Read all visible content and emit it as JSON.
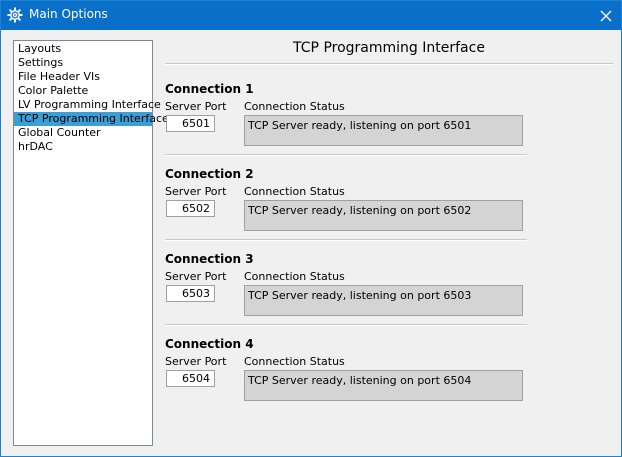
{
  "window": {
    "title": "Main Options",
    "title_icon": "gear-icon",
    "close_icon": "close-icon",
    "titlebar_color": "#0a6fc9"
  },
  "sidebar": {
    "items": [
      {
        "label": "Layouts",
        "selected": false
      },
      {
        "label": "Settings",
        "selected": false
      },
      {
        "label": "File Header VIs",
        "selected": false
      },
      {
        "label": "Color Palette",
        "selected": false
      },
      {
        "label": "LV Programming Interface",
        "selected": false
      },
      {
        "label": "TCP Programming Interface",
        "selected": true
      },
      {
        "label": "Global Counter",
        "selected": false
      },
      {
        "label": "hrDAC",
        "selected": false
      }
    ],
    "selected_color": "#3b9fd6"
  },
  "main": {
    "title": "TCP Programming Interface",
    "connections": [
      {
        "heading": "Connection 1",
        "port_label": "Server Port",
        "status_label": "Connection Status",
        "port": "6501",
        "status": "TCP Server ready, listening on port 6501"
      },
      {
        "heading": "Connection 2",
        "port_label": "Server Port",
        "status_label": "Connection Status",
        "port": "6502",
        "status": "TCP Server ready, listening on port 6502"
      },
      {
        "heading": "Connection 3",
        "port_label": "Server Port",
        "status_label": "Connection Status",
        "port": "6503",
        "status": "TCP Server ready, listening on port 6503"
      },
      {
        "heading": "Connection 4",
        "port_label": "Server Port",
        "status_label": "Connection Status",
        "port": "6504",
        "status": "TCP Server ready, listening on port 6504"
      }
    ]
  }
}
